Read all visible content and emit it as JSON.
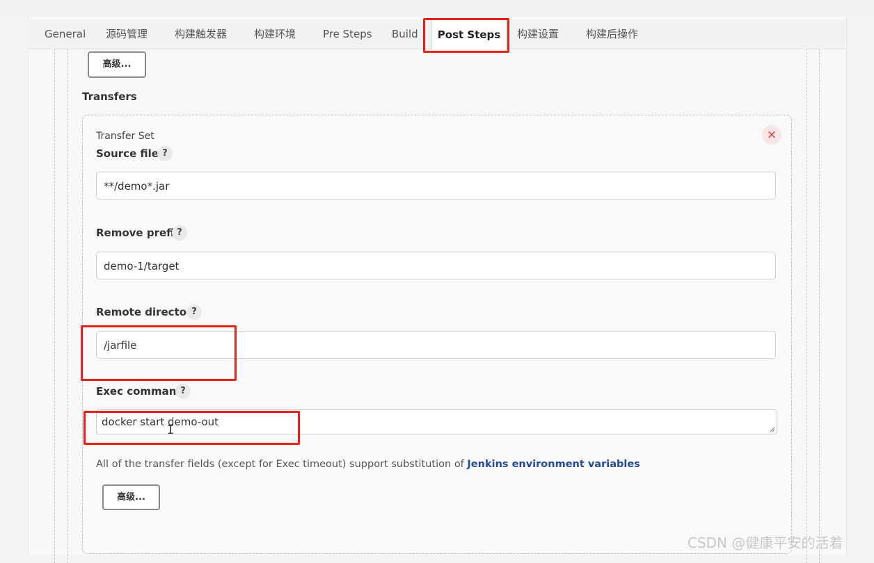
{
  "tabs": [
    {
      "label": "General"
    },
    {
      "label": "源码管理"
    },
    {
      "label": "构建触发器"
    },
    {
      "label": "构建环境"
    },
    {
      "label": "Pre Steps"
    },
    {
      "label": "Build"
    },
    {
      "label": "Post Steps",
      "active": true
    },
    {
      "label": "构建设置"
    },
    {
      "label": "构建后操作"
    }
  ],
  "advanced_top_label": "高级...",
  "transfers_title": "Transfers",
  "transfer_set": {
    "label": "Transfer Set",
    "close_symbol": "×",
    "source_files": {
      "label": "Source files",
      "value": "**/demo*.jar"
    },
    "remove_prefix": {
      "label": "Remove prefix",
      "value": "demo-1/target"
    },
    "remote_directory": {
      "label": "Remote directory",
      "value": "/jarfile"
    },
    "exec_command": {
      "label": "Exec command",
      "value": "docker start demo-out"
    },
    "help_symbol": "?",
    "info_text": "All of the transfer fields (except for Exec timeout) support substitution of ",
    "info_link": "Jenkins environment variables",
    "advanced_label": "高级..."
  },
  "watermark": "CSDN @健康平安的活着",
  "colors": {
    "highlight": "#e8201a",
    "link": "#244a99"
  }
}
